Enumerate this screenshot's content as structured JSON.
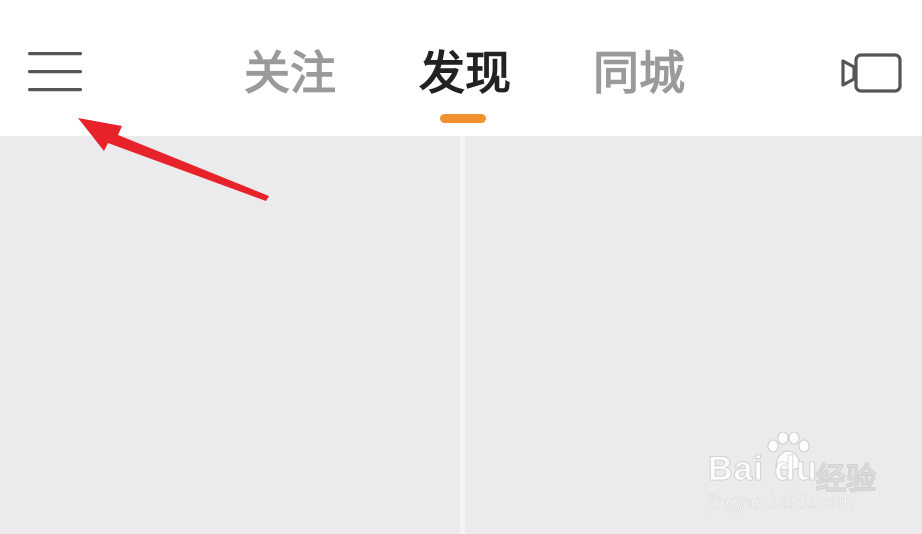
{
  "header": {
    "menu_icon": "hamburger-menu-icon",
    "camera_icon": "video-camera-icon",
    "tabs": [
      {
        "label": "关注",
        "active": false
      },
      {
        "label": "发现",
        "active": true
      },
      {
        "label": "同城",
        "active": false
      }
    ],
    "active_tab_color": "#222222",
    "inactive_tab_color": "#9a9a9a",
    "indicator_color": "#f0902f"
  },
  "feed": {
    "background": "#ebebed"
  },
  "annotation": {
    "arrow_color": "#e8222a",
    "points_to": "hamburger-menu-icon"
  },
  "watermark": {
    "logo": "Bai du",
    "brand": "经验",
    "url": "jingyan.baidu.com"
  }
}
